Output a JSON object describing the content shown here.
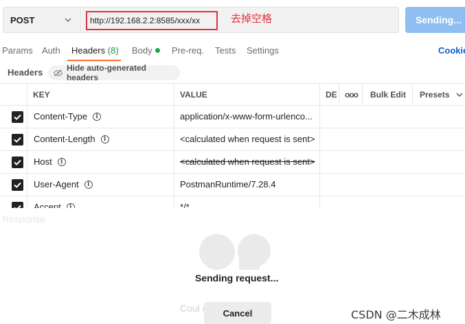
{
  "request": {
    "method": "POST",
    "url": "http://192.168.2.2:8585/xxx/xx",
    "annotation": "去掉空格",
    "send_label": "Sending..."
  },
  "tabs": [
    {
      "label": "Params"
    },
    {
      "label": "Auth"
    },
    {
      "label": "Headers",
      "count": "(8)",
      "active": true
    },
    {
      "label": "Body"
    },
    {
      "label": "Pre-req."
    },
    {
      "label": "Tests"
    },
    {
      "label": "Settings"
    }
  ],
  "cookies_label": "Cookie",
  "headers_bar": {
    "label": "Headers",
    "hide_button": "Hide auto-generated headers"
  },
  "table": {
    "columns": {
      "key": "KEY",
      "value": "VALUE",
      "description": "DE",
      "more": "ooo",
      "bulk_edit": "Bulk Edit",
      "presets": "Presets"
    },
    "rows": [
      {
        "key": "Content-Type",
        "value": "application/x-www-form-urlenco...",
        "checked": true,
        "struck": false
      },
      {
        "key": "Content-Length",
        "value": "<calculated when request is sent>",
        "checked": true,
        "struck": false
      },
      {
        "key": "Host",
        "value": "<calculated when request is sent>",
        "checked": true,
        "struck": true
      },
      {
        "key": "User-Agent",
        "value": "PostmanRuntime/7.28.4",
        "checked": true,
        "struck": false
      },
      {
        "key": "Accept",
        "value": "*/*",
        "checked": true,
        "struck": false
      }
    ]
  },
  "response": {
    "label": "Response",
    "status": "Sending request...",
    "behind_text": "Coul                          est",
    "cancel_label": "Cancel"
  },
  "watermark": "CSDN @二木成林",
  "colors": {
    "accent_orange": "#ff6c37",
    "send_button": "#8fbef2",
    "annotation_red": "#e3303a",
    "link_blue": "#0b5fcc",
    "count_green": "#1d8d3a"
  }
}
